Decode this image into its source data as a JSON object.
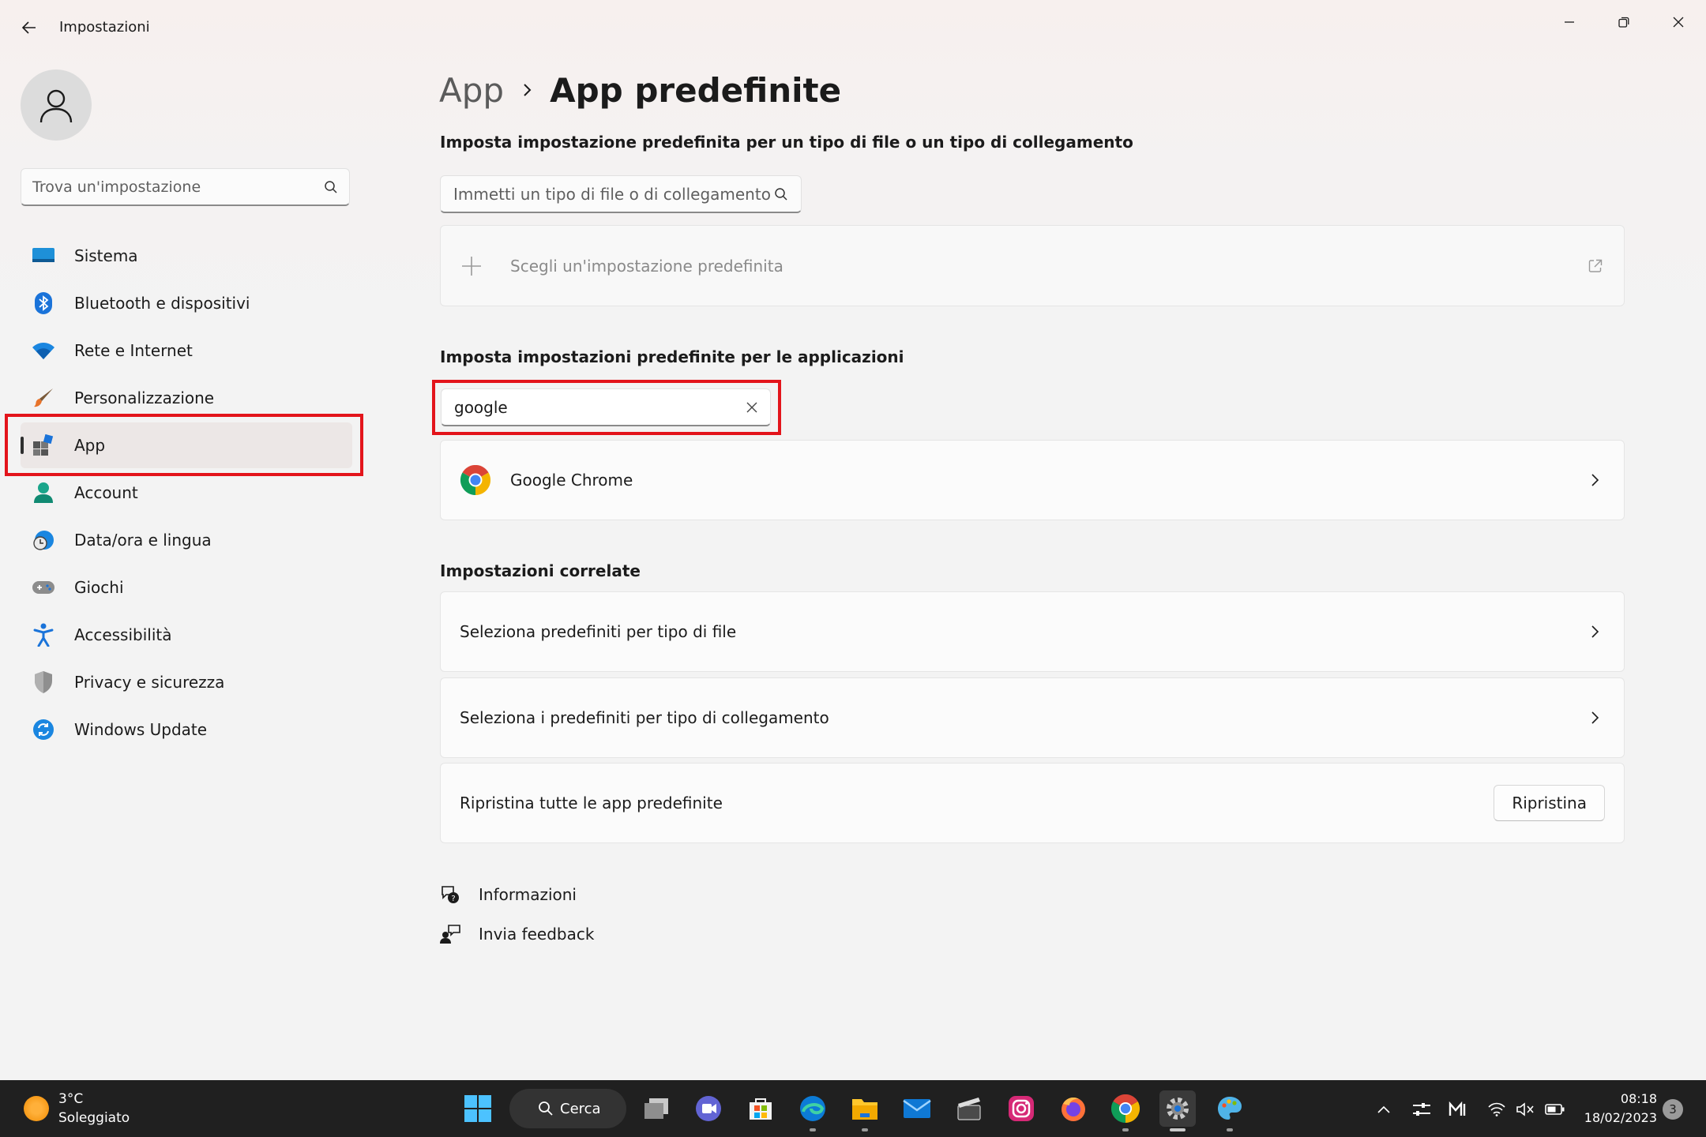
{
  "window": {
    "title": "Impostazioni"
  },
  "sidebar": {
    "search_placeholder": "Trova un'impostazione",
    "items": [
      {
        "label": "Sistema",
        "icon": "monitor-icon"
      },
      {
        "label": "Bluetooth e dispositivi",
        "icon": "bluetooth-icon"
      },
      {
        "label": "Rete e Internet",
        "icon": "wifi-icon"
      },
      {
        "label": "Personalizzazione",
        "icon": "brush-icon"
      },
      {
        "label": "App",
        "icon": "apps-icon",
        "active": true
      },
      {
        "label": "Account",
        "icon": "account-icon"
      },
      {
        "label": "Data/ora e lingua",
        "icon": "clock-globe-icon"
      },
      {
        "label": "Giochi",
        "icon": "gamepad-icon"
      },
      {
        "label": "Accessibilità",
        "icon": "accessibility-icon"
      },
      {
        "label": "Privacy e sicurezza",
        "icon": "shield-icon"
      },
      {
        "label": "Windows Update",
        "icon": "sync-icon"
      }
    ]
  },
  "main": {
    "breadcrumb": {
      "parent": "App",
      "current": "App predefinite"
    },
    "filetype_section": {
      "title": "Imposta impostazione predefinita per un tipo di file o un tipo di collegamento",
      "input_placeholder": "Immetti un tipo di file o di collegamento",
      "choose_default_label": "Scegli un'impostazione predefinita"
    },
    "apps_section": {
      "title": "Imposta impostazioni predefinite per le applicazioni",
      "search_value": "google",
      "results": [
        {
          "label": "Google Chrome",
          "icon": "chrome-icon"
        }
      ]
    },
    "related": {
      "title": "Impostazioni correlate",
      "items": [
        {
          "label": "Seleziona predefiniti per tipo di file"
        },
        {
          "label": "Seleziona i predefiniti per tipo di collegamento"
        }
      ],
      "reset": {
        "label": "Ripristina tutte le app predefinite",
        "button": "Ripristina"
      }
    },
    "links": [
      {
        "label": "Informazioni",
        "icon": "help-chat-icon"
      },
      {
        "label": "Invia feedback",
        "icon": "feedback-icon"
      }
    ]
  },
  "taskbar": {
    "weather": {
      "temp": "3°C",
      "condition": "Soleggiato"
    },
    "search_label": "Cerca",
    "clock": {
      "time": "08:18",
      "date": "18/02/2023"
    },
    "notifications": "3"
  },
  "colors": {
    "highlight": "#e3141b",
    "accent": "#0067c0",
    "taskbar": "#202020"
  }
}
